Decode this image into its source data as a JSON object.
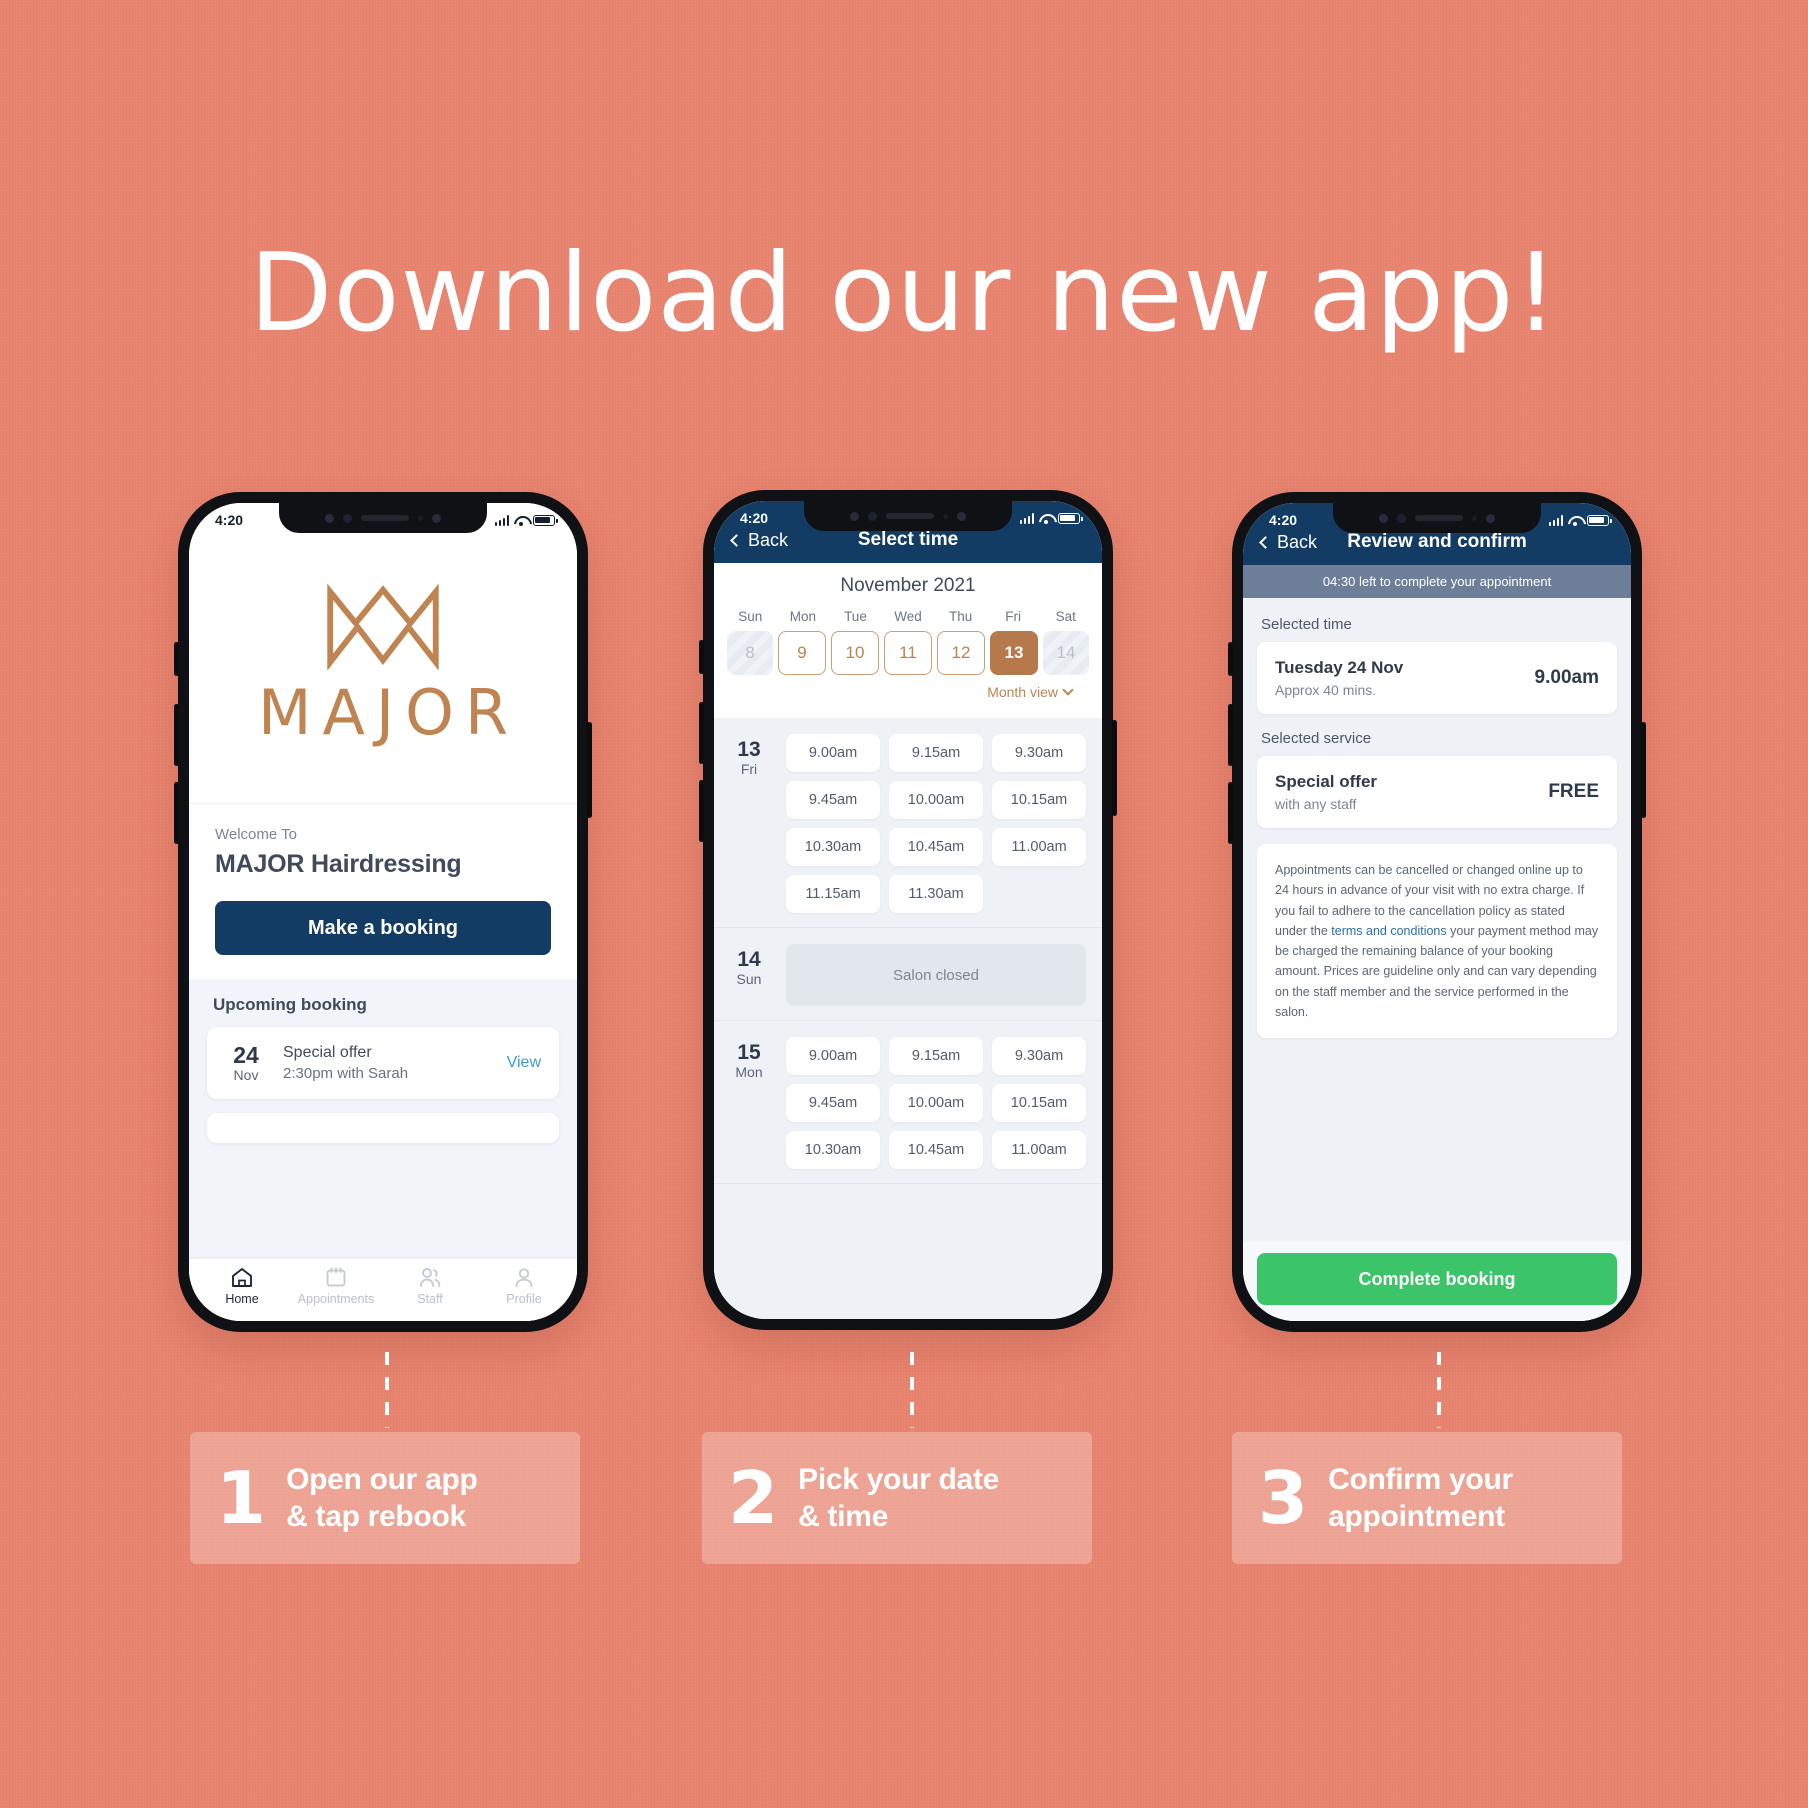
{
  "headline": "Download our new app!",
  "brand": {
    "accent_tan": "#c08452",
    "navy": "#123c63",
    "coral_bg": "#e8846f",
    "green": "#3cc469"
  },
  "phone1": {
    "status": {
      "time": "4:20"
    },
    "logo_word": "MAJOR",
    "welcome_small": "Welcome To",
    "salon_name": "MAJOR Hairdressing",
    "booking_button": "Make a booking",
    "upcoming_title": "Upcoming booking",
    "booking": {
      "day": "24",
      "month": "Nov",
      "service": "Special offer",
      "detail": "2:30pm with Sarah",
      "action": "View"
    },
    "tabs": [
      {
        "label": "Home",
        "icon": "home-icon",
        "active": true
      },
      {
        "label": "Appointments",
        "icon": "calendar-icon",
        "active": false
      },
      {
        "label": "Staff",
        "icon": "people-icon",
        "active": false
      },
      {
        "label": "Profile",
        "icon": "person-icon",
        "active": false
      }
    ]
  },
  "phone2": {
    "status": {
      "time": "4:20"
    },
    "nav": {
      "back": "Back",
      "title": "Select time"
    },
    "calendar": {
      "month": "November 2021",
      "dows": [
        "Sun",
        "Mon",
        "Tue",
        "Wed",
        "Thu",
        "Fri",
        "Sat"
      ],
      "days": [
        {
          "num": "8",
          "state": "off"
        },
        {
          "num": "9",
          "state": "avail"
        },
        {
          "num": "10",
          "state": "avail"
        },
        {
          "num": "11",
          "state": "avail"
        },
        {
          "num": "12",
          "state": "avail"
        },
        {
          "num": "13",
          "state": "sel"
        },
        {
          "num": "14",
          "state": "off"
        }
      ],
      "month_view": "Month view"
    },
    "groups": [
      {
        "num": "13",
        "dow": "Fri",
        "slots": [
          "9.00am",
          "9.15am",
          "9.30am",
          "9.45am",
          "10.00am",
          "10.15am",
          "10.30am",
          "10.45am",
          "11.00am",
          "11.15am",
          "11.30am"
        ]
      },
      {
        "num": "14",
        "dow": "Sun",
        "closed": "Salon closed",
        "slots": []
      },
      {
        "num": "15",
        "dow": "Mon",
        "slots": [
          "9.00am",
          "9.15am",
          "9.30am",
          "9.45am",
          "10.00am",
          "10.15am",
          "10.30am",
          "10.45am",
          "11.00am"
        ]
      }
    ]
  },
  "phone3": {
    "status": {
      "time": "4:20"
    },
    "nav": {
      "back": "Back",
      "title": "Review and confirm"
    },
    "timer": "04:30 left to complete your appointment",
    "selected_time_label": "Selected time",
    "selected_time": {
      "date": "Tuesday 24 Nov",
      "duration": "Approx 40 mins.",
      "time": "9.00am"
    },
    "selected_service_label": "Selected service",
    "selected_service": {
      "name": "Special offer",
      "staff": "with any staff",
      "price": "FREE"
    },
    "terms_part1": "Appointments can be cancelled or changed online up to 24 hours in advance of your visit with no extra charge. If you fail to adhere to the cancellation policy as stated under the ",
    "terms_link": "terms and conditions",
    "terms_part2": " your payment method may be charged the remaining balance of your booking amount. Prices are guideline only and can vary depending on the staff member and the service performed in the salon.",
    "complete_button": "Complete booking"
  },
  "captions": [
    {
      "number": "1",
      "line1": "Open our app",
      "line2": "& tap rebook"
    },
    {
      "number": "2",
      "line1": "Pick your date",
      "line2": "& time"
    },
    {
      "number": "3",
      "line1": "Confirm your",
      "line2": "appointment"
    }
  ]
}
